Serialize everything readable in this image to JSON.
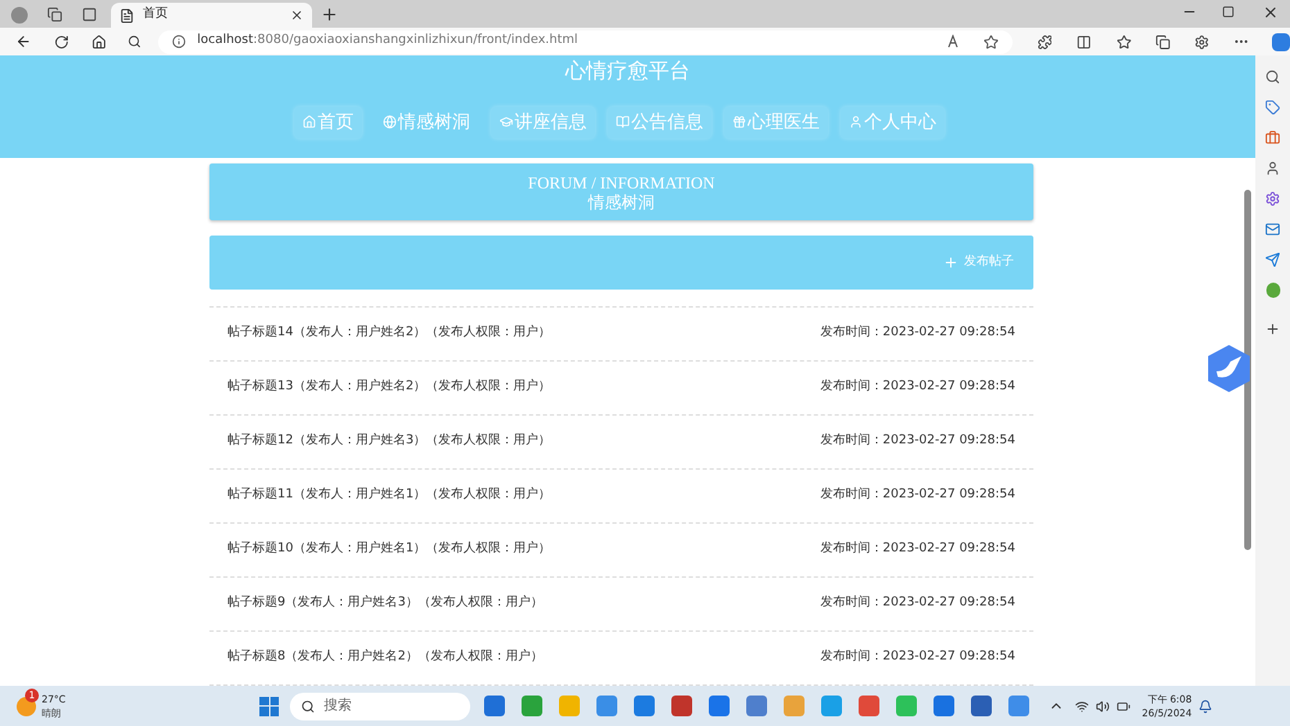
{
  "browser": {
    "tab_title": "首页",
    "url_host": "localhost",
    "url_rest": ":8080/gaoxiaoxianshangxinlizhixun/front/index.html"
  },
  "site_title": "心情疗愈平台",
  "nav": [
    {
      "label": "首页",
      "selected": false
    },
    {
      "label": "情感树洞",
      "selected": true
    },
    {
      "label": "讲座信息",
      "selected": false
    },
    {
      "label": "公告信息",
      "selected": false
    },
    {
      "label": "心理医生",
      "selected": false
    },
    {
      "label": "个人中心",
      "selected": false
    }
  ],
  "section": {
    "title_en": "FORUM / INFORMATION",
    "title_cn": "情感树洞"
  },
  "post_button": "发布帖子",
  "posts": [
    {
      "title": "帖子标题14（发布人：用户姓名2）（发布人权限：用户）",
      "time": "发布时间：2023-02-27 09:28:54"
    },
    {
      "title": "帖子标题13（发布人：用户姓名2）（发布人权限：用户）",
      "time": "发布时间：2023-02-27 09:28:54"
    },
    {
      "title": "帖子标题12（发布人：用户姓名3）（发布人权限：用户）",
      "time": "发布时间：2023-02-27 09:28:54"
    },
    {
      "title": "帖子标题11（发布人：用户姓名1）（发布人权限：用户）",
      "time": "发布时间：2023-02-27 09:28:54"
    },
    {
      "title": "帖子标题10（发布人：用户姓名1）（发布人权限：用户）",
      "time": "发布时间：2023-02-27 09:28:54"
    },
    {
      "title": "帖子标题9（发布人：用户姓名3）（发布人权限：用户）",
      "time": "发布时间：2023-02-27 09:28:54"
    },
    {
      "title": "帖子标题8（发布人：用户姓名2）（发布人权限：用户）",
      "time": "发布时间：2023-02-27 09:28:54"
    }
  ],
  "taskbar": {
    "weather_badge": "1",
    "temperature": "27°C",
    "condition": "晴朗",
    "search_placeholder": "搜索",
    "time": "下午 6:08",
    "date": "26/5/2024"
  }
}
